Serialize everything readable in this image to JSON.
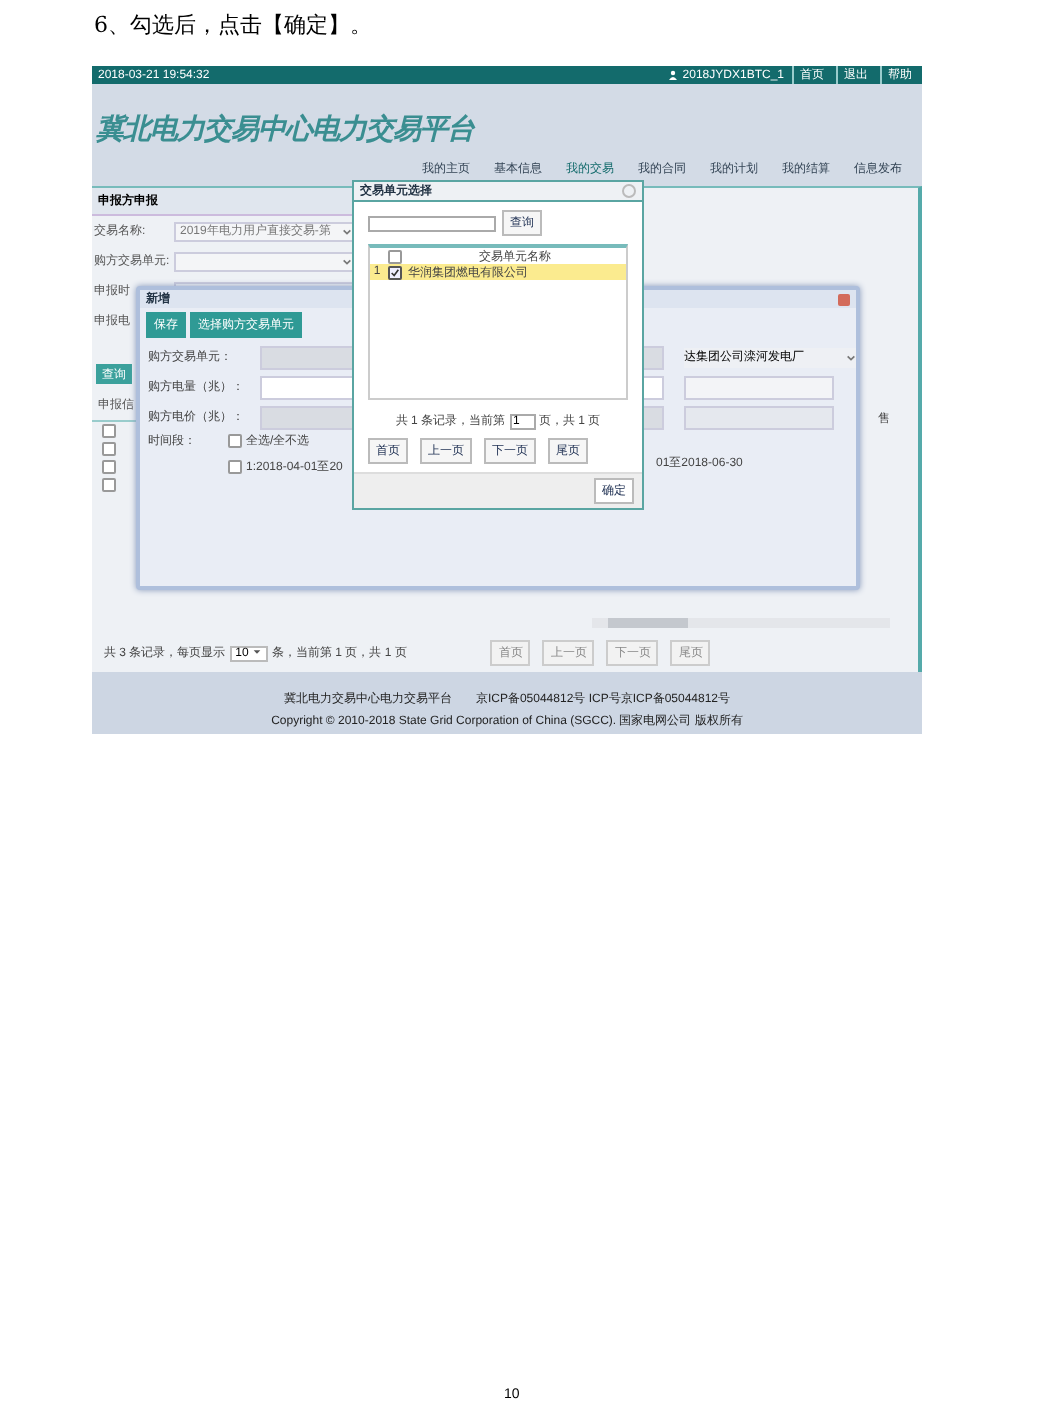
{
  "instruction": "6、勾选后，点击【确定】。",
  "screenshot": {
    "top_bar": {
      "datetime": "2018-03-21 19:54:32",
      "user": "2018JYDX1BTC_1",
      "links": [
        "首页",
        "退出",
        "帮助"
      ]
    },
    "site_title": "冀北电力交易中心电力交易平台",
    "nav": [
      {
        "label": "我的主页",
        "selected": false
      },
      {
        "label": "基本信息",
        "selected": false
      },
      {
        "label": "我的交易",
        "selected": true
      },
      {
        "label": "我的合同",
        "selected": false
      },
      {
        "label": "我的计划",
        "selected": false
      },
      {
        "label": "我的结算",
        "selected": false
      },
      {
        "label": "信息发布",
        "selected": false
      }
    ],
    "left_panel": {
      "title": "申报方申报",
      "fields": [
        {
          "label": "交易名称:",
          "value": "2019年电力用户直接交易-第",
          "kind": "select"
        },
        {
          "label": "购方交易单元:",
          "kind": "select"
        },
        {
          "label": "申报时",
          "kind": "text"
        },
        {
          "label": "申报电",
          "kind": "text"
        }
      ],
      "query_button": "查询",
      "tab": "申报信",
      "column_cut": "售",
      "rows": [
        {
          "checked": false
        },
        {
          "checked": false
        },
        {
          "checked": false
        },
        {
          "checked": false
        }
      ],
      "pager": {
        "text": "共 3 条记录，每页显示",
        "page_size": "10",
        "text_after": "条，当前第 1 页，共 1 页",
        "buttons": [
          {
            "label": "首页",
            "disabled": true
          },
          {
            "label": "上一页",
            "disabled": true
          },
          {
            "label": "下一页",
            "disabled": true
          },
          {
            "label": "尾页",
            "disabled": true
          }
        ]
      }
    },
    "footer": [
      "冀北电力交易中心电力交易平台　　京ICP备05044812号 ICP号京ICP备05044812号",
      "Copyright © 2010-2018 State Grid Corporation of China (SGCC). 国家电网公司 版权所有"
    ],
    "add_modal": {
      "title": "新增",
      "buttons": [
        "保存",
        "选择购方交易单元"
      ],
      "fields": [
        {
          "label": "购方交易单元：",
          "disabled": true
        },
        {
          "label": "购方电量（兆）：",
          "disabled": false
        },
        {
          "label": "购方电价（兆）：",
          "disabled": true
        }
      ],
      "right_select": "达集团公司滦河发电厂",
      "time_label": "时间段：",
      "time_options": [
        {
          "label": "全选/全不选",
          "checked": false
        },
        {
          "label": "1:2018-04-01至20",
          "checked": false
        }
      ],
      "time_continuation": "01至2018-06-30"
    },
    "unit_dialog": {
      "title": "交易单元选择",
      "search_button": "查询",
      "column": "交易单元名称",
      "header_checked": false,
      "rows": [
        {
          "index": "1",
          "name": "华润集团燃电有限公司",
          "checked": true,
          "selected": true
        }
      ],
      "pager_before": "共 1 条记录，当前第",
      "page": "1",
      "pager_after": "页，共 1 页",
      "buttons": [
        "首页",
        "上一页",
        "下一页",
        "尾页"
      ],
      "confirm": "确定"
    }
  },
  "page_number": "10"
}
